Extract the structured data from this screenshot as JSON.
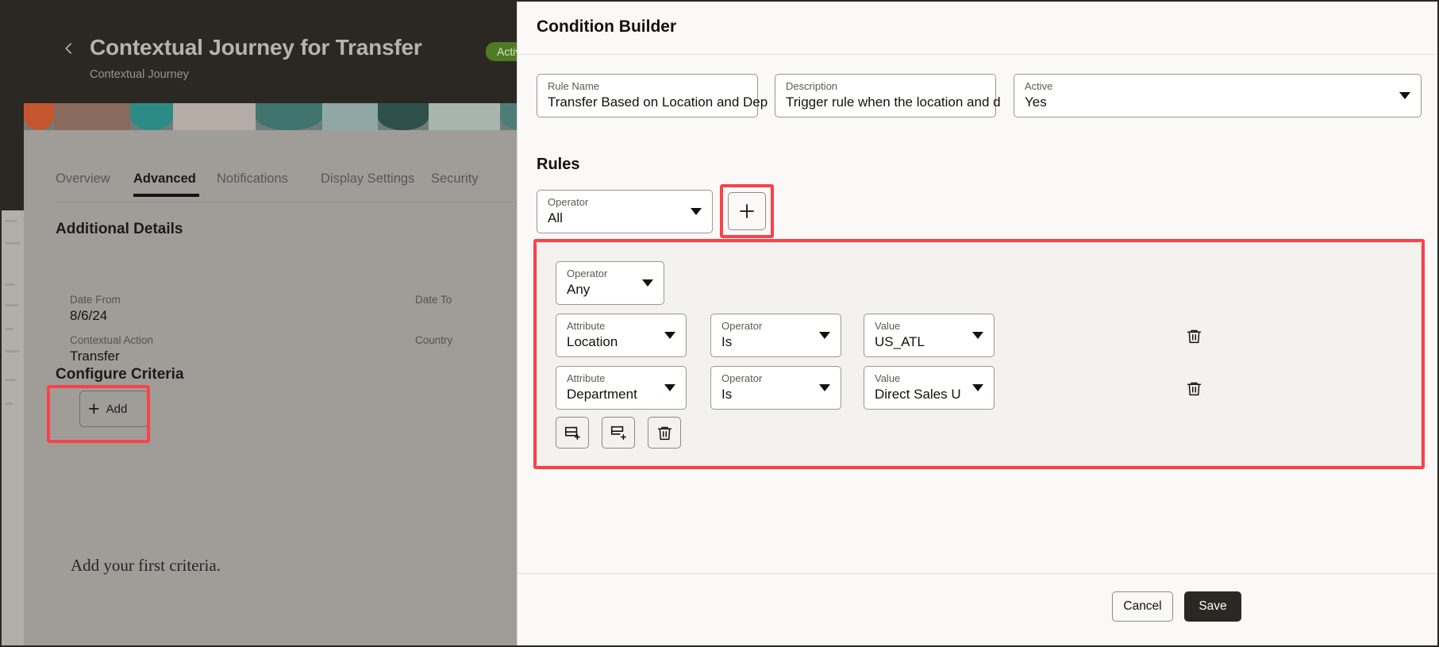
{
  "background": {
    "back_icon": "chevron-left-icon",
    "title": "Contextual Journey for Transfer",
    "status_badge": "Active",
    "subtitle": "Contextual Journey",
    "tabs": [
      {
        "label": "Overview",
        "active": false
      },
      {
        "label": "Advanced",
        "active": true
      },
      {
        "label": "Notifications",
        "active": false
      },
      {
        "label": "Display Settings",
        "active": false
      },
      {
        "label": "Security",
        "active": false
      }
    ],
    "additional_details": {
      "heading": "Additional Details",
      "fields": [
        {
          "label": "Date From",
          "value": "8/6/24"
        },
        {
          "label": "Date To",
          "value": ""
        },
        {
          "label": "Contextual Action",
          "value": "Transfer"
        },
        {
          "label": "Country",
          "value": ""
        }
      ]
    },
    "configure_criteria": {
      "heading": "Configure Criteria",
      "add_label": "Add",
      "add_icon": "plus-icon",
      "empty_message": "Add your first criteria."
    }
  },
  "panel": {
    "title": "Condition Builder",
    "fields": [
      {
        "label": "Rule Name",
        "value": "Transfer Based on Location and Dep",
        "type": "text"
      },
      {
        "label": "Description",
        "value": "Trigger rule when the location and d",
        "type": "text"
      },
      {
        "label": "Active",
        "value": "Yes",
        "type": "select"
      }
    ],
    "rules": {
      "heading": "Rules",
      "root_operator": {
        "label": "Operator",
        "value": "All"
      },
      "add_group_icon": "plus-icon",
      "group": {
        "operator": {
          "label": "Operator",
          "value": "Any"
        },
        "conditions": [
          {
            "attribute": {
              "label": "Attribute",
              "value": "Location"
            },
            "operator": {
              "label": "Operator",
              "value": "Is"
            },
            "value": {
              "label": "Value",
              "value": "US_ATL"
            },
            "delete_icon": "trash-icon"
          },
          {
            "attribute": {
              "label": "Attribute",
              "value": "Department"
            },
            "operator": {
              "label": "Operator",
              "value": "Is"
            },
            "value": {
              "label": "Value",
              "value": "Direct Sales U"
            },
            "delete_icon": "trash-icon"
          }
        ],
        "actions": [
          {
            "icon": "add-condition-icon"
          },
          {
            "icon": "add-group-icon"
          },
          {
            "icon": "trash-icon"
          }
        ]
      }
    },
    "footer": {
      "cancel_label": "Cancel",
      "save_label": "Save"
    }
  },
  "highlights": {
    "accent_color": "#f9424b",
    "count": 3
  }
}
